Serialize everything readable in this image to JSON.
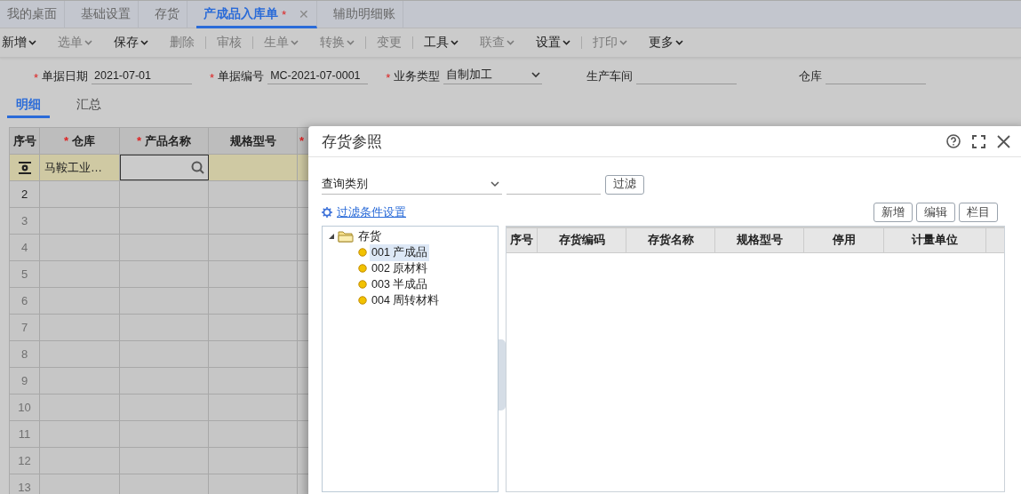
{
  "tabs": [
    {
      "label": "我的桌面",
      "selected": false
    },
    {
      "label": "基础设置",
      "selected": false
    },
    {
      "label": "存货",
      "selected": false
    },
    {
      "label": "产成品入库单",
      "selected": true,
      "modified_mark": "*",
      "close": "✕"
    },
    {
      "label": "辅助明细账",
      "selected": false
    }
  ],
  "toolbar": [
    {
      "label": "新增",
      "disabled": false,
      "dropdown": true,
      "separator_after": false
    },
    {
      "label": "选单",
      "disabled": true,
      "dropdown": true,
      "separator_after": false
    },
    {
      "label": "保存",
      "disabled": false,
      "dropdown": true,
      "separator_after": false
    },
    {
      "label": "删除",
      "disabled": true,
      "dropdown": false,
      "separator_after": true
    },
    {
      "label": "审核",
      "disabled": true,
      "dropdown": false,
      "separator_after": true
    },
    {
      "label": "生单",
      "disabled": true,
      "dropdown": true,
      "separator_after": false
    },
    {
      "label": "转换",
      "disabled": true,
      "dropdown": true,
      "separator_after": true
    },
    {
      "label": "变更",
      "disabled": true,
      "dropdown": false,
      "separator_after": true
    },
    {
      "label": "工具",
      "disabled": false,
      "dropdown": true,
      "separator_after": false
    },
    {
      "label": "联查",
      "disabled": true,
      "dropdown": true,
      "separator_after": false
    },
    {
      "label": "设置",
      "disabled": false,
      "dropdown": true,
      "separator_after": true
    },
    {
      "label": "打印",
      "disabled": true,
      "dropdown": true,
      "separator_after": false
    },
    {
      "label": "更多",
      "disabled": false,
      "dropdown": true,
      "separator_after": false
    }
  ],
  "form": [
    {
      "label": "单据日期",
      "required": true,
      "kind": "text",
      "value": "2021-07-01"
    },
    {
      "label": "单据编号",
      "required": true,
      "kind": "text",
      "value": "MC-2021-07-0001"
    },
    {
      "label": "业务类型",
      "required": true,
      "kind": "select",
      "value": "自制加工"
    },
    {
      "label": "生产车间",
      "required": false,
      "kind": "text"
    },
    {
      "label": "仓库",
      "required": false,
      "kind": "text"
    }
  ],
  "subtabs": [
    {
      "label": "明细",
      "selected": true
    },
    {
      "label": "汇总",
      "selected": false
    }
  ],
  "table": {
    "columns": [
      {
        "label": "序号",
        "required": false
      },
      {
        "label": "仓库",
        "required": true
      },
      {
        "label": "产品名称",
        "required": true
      },
      {
        "label": "规格型号",
        "required": false
      },
      {
        "required": true
      }
    ],
    "rows": [
      {
        "number_icon": true,
        "selected": true,
        "disabled": false,
        "cells": [
          "马鞍工业…"
        ],
        "editing_cell": true
      },
      {
        "number": "2",
        "selected": false,
        "disabled": false
      },
      {
        "number": "3",
        "selected": false,
        "disabled": true
      },
      {
        "number": "4",
        "selected": false,
        "disabled": true
      },
      {
        "number": "5",
        "selected": false,
        "disabled": true
      },
      {
        "number": "6",
        "selected": false,
        "disabled": true
      },
      {
        "number": "7",
        "selected": false,
        "disabled": true
      },
      {
        "number": "8",
        "selected": false,
        "disabled": true
      },
      {
        "number": "9",
        "selected": false,
        "disabled": true
      },
      {
        "number": "10",
        "selected": false,
        "disabled": true
      },
      {
        "number": "11",
        "selected": false,
        "disabled": true
      },
      {
        "number": "12",
        "selected": false,
        "disabled": true
      },
      {
        "number": "13",
        "selected": false,
        "disabled": true
      }
    ]
  },
  "dialog": {
    "title": "存货参照",
    "query_select": {
      "value": "查询类别"
    },
    "filter_button": "过滤",
    "filter_settings_link": "过滤条件设置",
    "buttons": [
      "新增",
      "编辑",
      "栏目"
    ],
    "tree": [
      {
        "label": "存货",
        "expanded": true,
        "selected": false,
        "children": [
          {
            "label": "001 产成品",
            "selected": true
          },
          {
            "label": "002 原材料",
            "selected": false
          },
          {
            "label": "003 半成品",
            "selected": false
          },
          {
            "label": "004 周转材料",
            "selected": false
          }
        ]
      }
    ],
    "grid_columns": [
      "序号",
      "存货编码",
      "存货名称",
      "规格型号",
      "停用",
      "计量单位"
    ]
  }
}
